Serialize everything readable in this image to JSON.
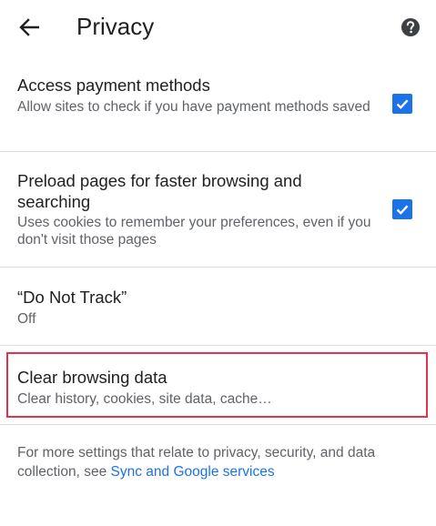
{
  "header": {
    "title": "Privacy",
    "back_icon": "arrow-back-icon",
    "help_icon": "help-icon"
  },
  "settings": [
    {
      "title": "Access payment methods",
      "summary": "Allow sites to check if you have payment methods saved",
      "checked": true
    },
    {
      "title": "Preload pages for faster browsing and searching",
      "summary": "Uses cookies to remember your preferences, even if you don't visit those pages",
      "checked": true
    },
    {
      "title": "“Do Not Track”",
      "summary": "Off"
    },
    {
      "title": "Clear browsing data",
      "summary": "Clear history, cookies, site data, cache…"
    }
  ],
  "footer": {
    "text": "For more settings that relate to privacy, security, and data collection, see ",
    "link": "Sync and Google services"
  },
  "colors": {
    "accent": "#1a73e8",
    "highlight_border": "#e8304a",
    "divider": "#dadce0"
  }
}
